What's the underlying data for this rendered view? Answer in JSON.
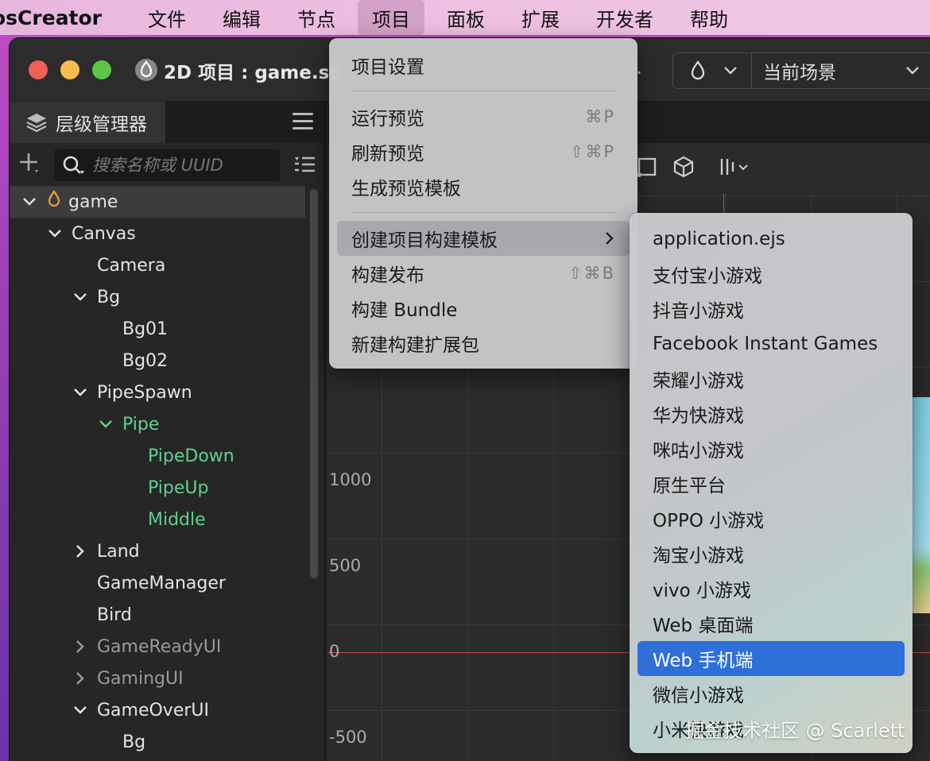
{
  "menubar": {
    "app_name": "osCreator",
    "items": [
      "文件",
      "编辑",
      "节点",
      "项目",
      "面板",
      "扩展",
      "开发者",
      "帮助"
    ],
    "active_index": 3
  },
  "window": {
    "title": "2D 项目 : game.sc",
    "more": ".",
    "scene_selector": "当前场景"
  },
  "hierarchy": {
    "tab_label": "层级管理器",
    "search_placeholder": "搜索名称或 UUID",
    "nodes": [
      {
        "label": "game",
        "depth": 0,
        "arrow": "down",
        "selected": true,
        "icon": "flame-icon"
      },
      {
        "label": "Canvas",
        "depth": 1,
        "arrow": "down"
      },
      {
        "label": "Camera",
        "depth": 2,
        "arrow": "none"
      },
      {
        "label": "Bg",
        "depth": 2,
        "arrow": "down"
      },
      {
        "label": "Bg01",
        "depth": 3,
        "arrow": "none"
      },
      {
        "label": "Bg02",
        "depth": 3,
        "arrow": "none"
      },
      {
        "label": "PipeSpawn",
        "depth": 2,
        "arrow": "down"
      },
      {
        "label": "Pipe",
        "depth": 3,
        "arrow": "down",
        "style": "green"
      },
      {
        "label": "PipeDown",
        "depth": 4,
        "arrow": "none",
        "style": "green"
      },
      {
        "label": "PipeUp",
        "depth": 4,
        "arrow": "none",
        "style": "green"
      },
      {
        "label": "Middle",
        "depth": 4,
        "arrow": "none",
        "style": "green"
      },
      {
        "label": "Land",
        "depth": 2,
        "arrow": "right"
      },
      {
        "label": "GameManager",
        "depth": 2,
        "arrow": "none"
      },
      {
        "label": "Bird",
        "depth": 2,
        "arrow": "none"
      },
      {
        "label": "GameReadyUI",
        "depth": 2,
        "arrow": "right",
        "style": "dim"
      },
      {
        "label": "GamingUI",
        "depth": 2,
        "arrow": "right",
        "style": "dim"
      },
      {
        "label": "GameOverUI",
        "depth": 2,
        "arrow": "down"
      },
      {
        "label": "Bg",
        "depth": 3,
        "arrow": "none"
      }
    ]
  },
  "scene": {
    "axis_labels": [
      {
        "text": "1000",
        "value": 1000
      },
      {
        "text": "500",
        "value": 500
      },
      {
        "text": "0",
        "value": 0
      },
      {
        "text": "-500",
        "value": -500
      }
    ]
  },
  "project_menu": {
    "groups": [
      [
        {
          "label": "项目设置",
          "shortcut": ""
        }
      ],
      [
        {
          "label": "运行预览",
          "shortcut": "⌘P"
        },
        {
          "label": "刷新预览",
          "shortcut": "⇧⌘P"
        },
        {
          "label": "生成预览模板",
          "shortcut": ""
        }
      ],
      [
        {
          "label": "创建项目构建模板",
          "shortcut": "",
          "submenu": true,
          "highlighted": true
        },
        {
          "label": "构建发布",
          "shortcut": "⇧⌘B"
        },
        {
          "label": "构建 Bundle",
          "shortcut": ""
        },
        {
          "label": "新建构建扩展包",
          "shortcut": ""
        }
      ]
    ]
  },
  "build_template_submenu": {
    "items": [
      "application.ejs",
      "支付宝小游戏",
      "抖音小游戏",
      "Facebook Instant Games",
      "荣耀小游戏",
      "华为快游戏",
      "咪咕小游戏",
      "原生平台",
      "OPPO 小游戏",
      "淘宝小游戏",
      "vivo 小游戏",
      "Web 桌面端",
      "Web 手机端",
      "微信小游戏",
      "小米快游戏"
    ],
    "selected_index": 12
  },
  "watermark": "掘金技术社区 @ Scarlett"
}
